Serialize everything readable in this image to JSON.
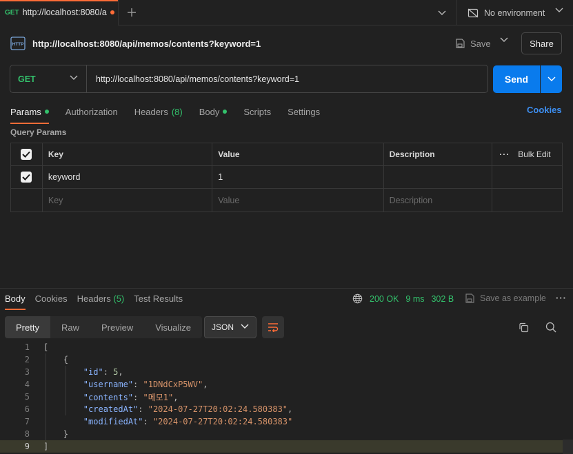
{
  "tab": {
    "method": "GET",
    "title": "http://localhost:8080/ap"
  },
  "environment": {
    "label": "No environment"
  },
  "request": {
    "title": "http://localhost:8080/api/memos/contents?keyword=1",
    "save_label": "Save",
    "share_label": "Share",
    "method": "GET",
    "url": "http://localhost:8080/api/memos/contents?keyword=1",
    "send_label": "Send"
  },
  "request_tabs": [
    {
      "label": "Params",
      "dot": true
    },
    {
      "label": "Authorization"
    },
    {
      "label": "Headers",
      "count": "(8)"
    },
    {
      "label": "Body",
      "dot": true
    },
    {
      "label": "Scripts"
    },
    {
      "label": "Settings"
    }
  ],
  "cookies_label": "Cookies",
  "query_params": {
    "label": "Query Params",
    "headers": {
      "key": "Key",
      "value": "Value",
      "description": "Description",
      "bulk_edit": "Bulk Edit"
    },
    "rows": [
      {
        "key": "keyword",
        "value": "1",
        "checked": true
      }
    ],
    "placeholders": {
      "key": "Key",
      "value": "Value",
      "description": "Description"
    }
  },
  "response": {
    "tabs": [
      {
        "label": "Body"
      },
      {
        "label": "Cookies"
      },
      {
        "label": "Headers",
        "count": "(5)"
      },
      {
        "label": "Test Results"
      }
    ],
    "status": "200 OK",
    "time": "9 ms",
    "size": "302 B",
    "save_example": "Save as example",
    "view_modes": [
      "Pretty",
      "Raw",
      "Preview",
      "Visualize"
    ],
    "format": "JSON",
    "lines": [
      "1",
      "2",
      "3",
      "4",
      "5",
      "6",
      "7",
      "8",
      "9"
    ],
    "json": {
      "id_key": "\"id\"",
      "id_val": "5",
      "username_key": "\"username\"",
      "username_val": "\"1DNdCxP5WV\"",
      "contents_key": "\"contents\"",
      "contents_val": "\"메모1\"",
      "createdAt_key": "\"createdAt\"",
      "createdAt_val": "\"2024-07-27T20:02:24.580383\"",
      "modifiedAt_key": "\"modifiedAt\"",
      "modifiedAt_val": "\"2024-07-27T20:02:24.580383\""
    }
  },
  "colors": {
    "accent": "#ff6c37",
    "send": "#097bed",
    "get": "#33c26c",
    "link": "#3d8ef0"
  }
}
